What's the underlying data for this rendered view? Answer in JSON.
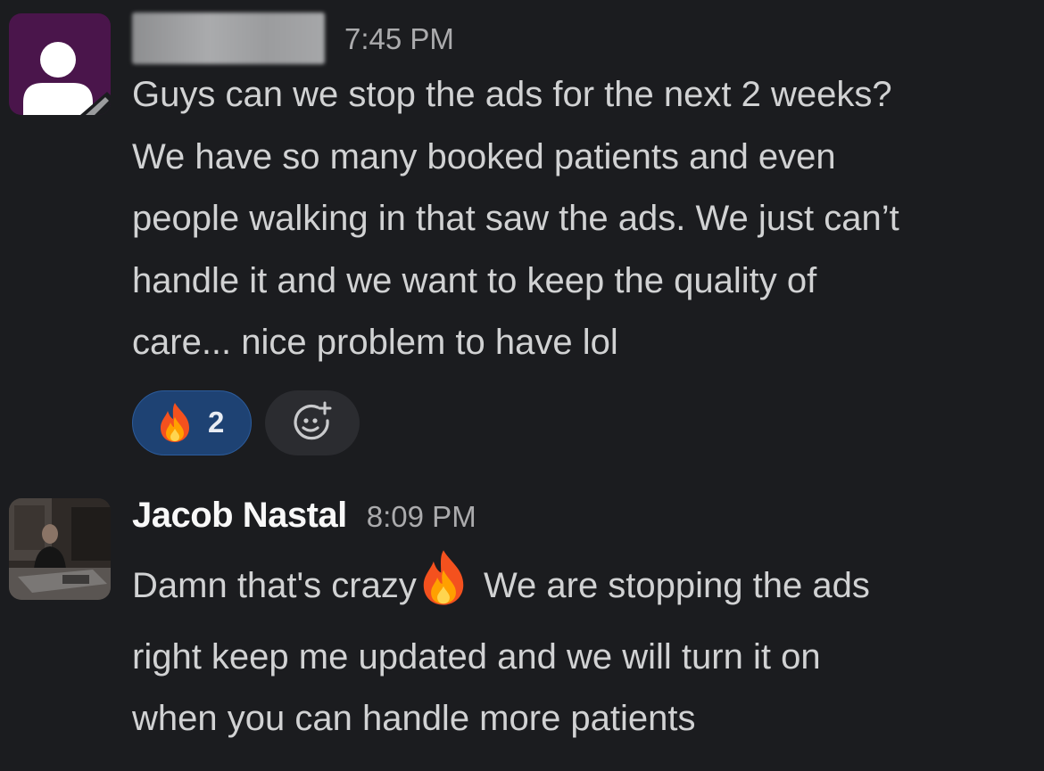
{
  "messages": [
    {
      "author": "",
      "author_redacted": true,
      "avatar": "default-user-avatar",
      "time": "7:45 PM",
      "lines": [
        "Guys can we stop the ads for the next 2 weeks?",
        "We have so many booked patients and even",
        "people walking in that saw the ads. We just can’t",
        "handle it and we want to keep the quality of",
        "care... nice problem to have lol"
      ],
      "reactions": [
        {
          "emoji": "fire-icon",
          "count": "2"
        }
      ],
      "add_reaction_icon": "add-reaction-icon"
    },
    {
      "author": "Jacob Nastal",
      "avatar": "photo-avatar",
      "time": "8:09 PM",
      "line1_before": "Damn that's crazy",
      "line1_emoji": "fire-icon",
      "line1_after": "We are stopping the ads",
      "lines_rest": [
        "right keep me updated and we will turn it on",
        "when you can handle more patients"
      ]
    }
  ],
  "colors": {
    "background": "#1b1c1f",
    "text": "#d1d2d3",
    "timestamp": "#ababad",
    "reaction_active_bg": "#1e4273",
    "avatar_default_bg": "#4a154b"
  }
}
